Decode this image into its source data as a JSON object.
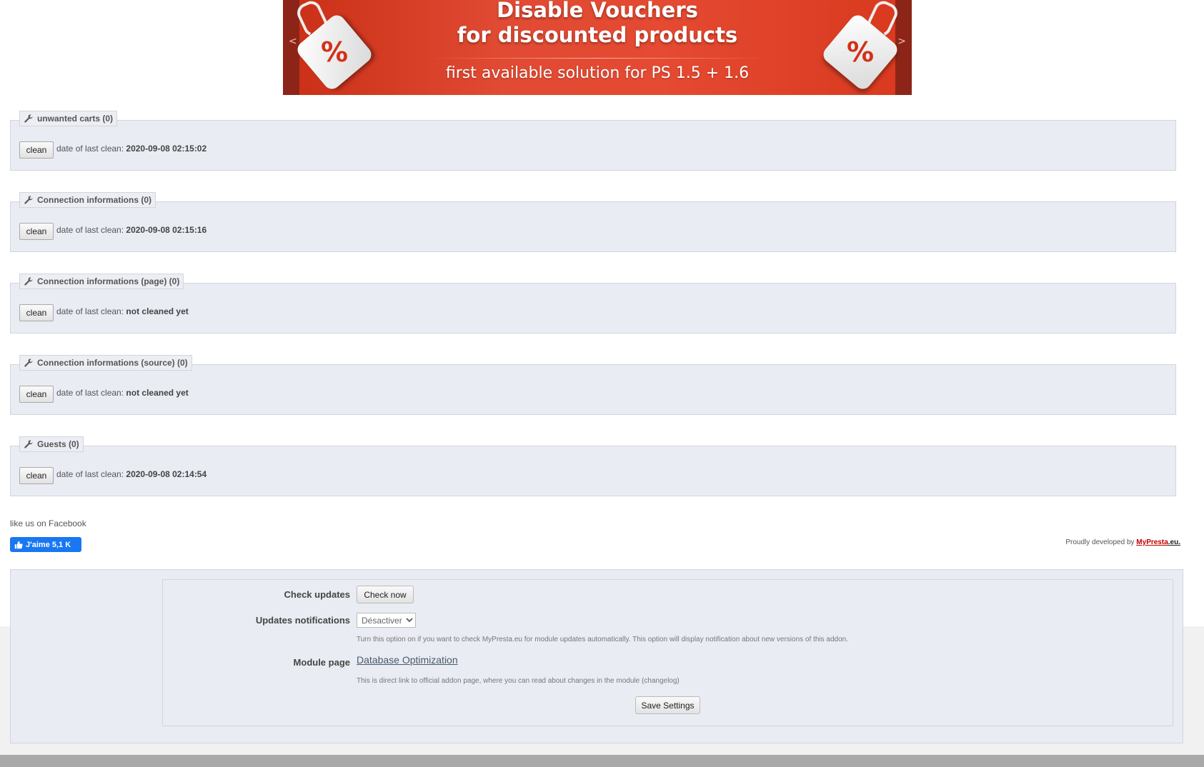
{
  "banner": {
    "title_line1": "Disable Vouchers",
    "title_line2": "for discounted products",
    "subtitle": "first available solution for PS 1.5 + 1.6",
    "tag_symbol": "%",
    "prev_arrow": "<",
    "next_arrow": ">"
  },
  "sections": [
    {
      "title": "unwanted carts (0)",
      "clean_label": "clean",
      "last_clean_label": "date of last clean:",
      "last_clean_value": "2020-09-08 02:15:02"
    },
    {
      "title": "Connection informations (0)",
      "clean_label": "clean",
      "last_clean_label": "date of last clean:",
      "last_clean_value": "2020-09-08 02:15:16"
    },
    {
      "title": "Connection informations (page) (0)",
      "clean_label": "clean",
      "last_clean_label": "date of last clean:",
      "last_clean_value": "not cleaned yet"
    },
    {
      "title": "Connection informations (source) (0)",
      "clean_label": "clean",
      "last_clean_label": "date of last clean:",
      "last_clean_value": "not cleaned yet"
    },
    {
      "title": "Guests (0)",
      "clean_label": "clean",
      "last_clean_label": "date of last clean:",
      "last_clean_value": "2020-09-08 02:14:54"
    }
  ],
  "facebook": {
    "text": "like us on Facebook",
    "button_label": "J'aime 5,1 K"
  },
  "credits": {
    "prefix": "Proudly developed by",
    "brand": "MyPresta",
    "suffix": ".eu."
  },
  "settings": {
    "check_updates_label": "Check updates",
    "check_now_button": "Check now",
    "updates_notifications_label": "Updates notifications",
    "updates_notifications_value": "Désactiver",
    "updates_notifications_hint": "Turn this option on if you want to check MyPresta.eu for module updates automatically. This option will display notification about new versions of this addon.",
    "module_page_label": "Module page",
    "module_page_link": "Database Optimization",
    "module_page_hint": "This is direct link to official addon page, where you can read about changes in the module (changelog)",
    "save_button": "Save Settings"
  },
  "colors": {
    "section_bg": "#e9ecf3",
    "banner_red": "#e14a33",
    "facebook_blue": "#1877f2",
    "brand_red": "#c00000"
  }
}
